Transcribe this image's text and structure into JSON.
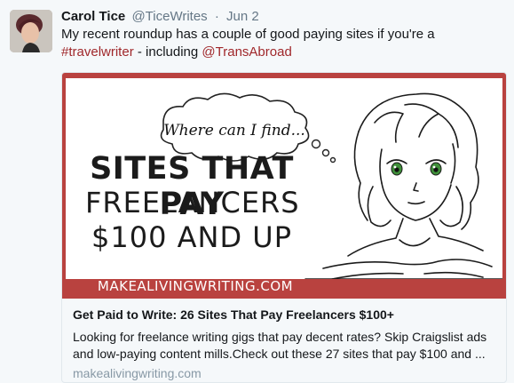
{
  "tweet": {
    "author_name": "Carol Tice",
    "author_handle": "@TiceWrites",
    "separator": "·",
    "date": "Jun 2",
    "text_before": "My recent roundup has a couple of good paying sites if you're a ",
    "hashtag": "#travelwriter",
    "text_middle": " - including ",
    "mention": "@TransAbroad"
  },
  "card": {
    "image": {
      "thought": "Where can I find...",
      "headline_line1": "SITES THAT PAY",
      "headline_line2": "FREELANCERS",
      "headline_line3": "$100 AND UP",
      "banner_url": "MAKEALIVINGWRITING.COM",
      "brand_color": "#b9423f"
    },
    "title": "Get Paid to Write: 26 Sites That Pay Freelancers $100+",
    "description": "Looking for freelance writing gigs that pay decent rates? Skip Craigslist ads and low-paying content mills.Check out these 27 sites that pay $100 and ...",
    "domain": "makealivingwriting.com"
  },
  "colors": {
    "link": "#a0282b",
    "secondary_text": "#657786",
    "domain_text": "#8899a6"
  }
}
